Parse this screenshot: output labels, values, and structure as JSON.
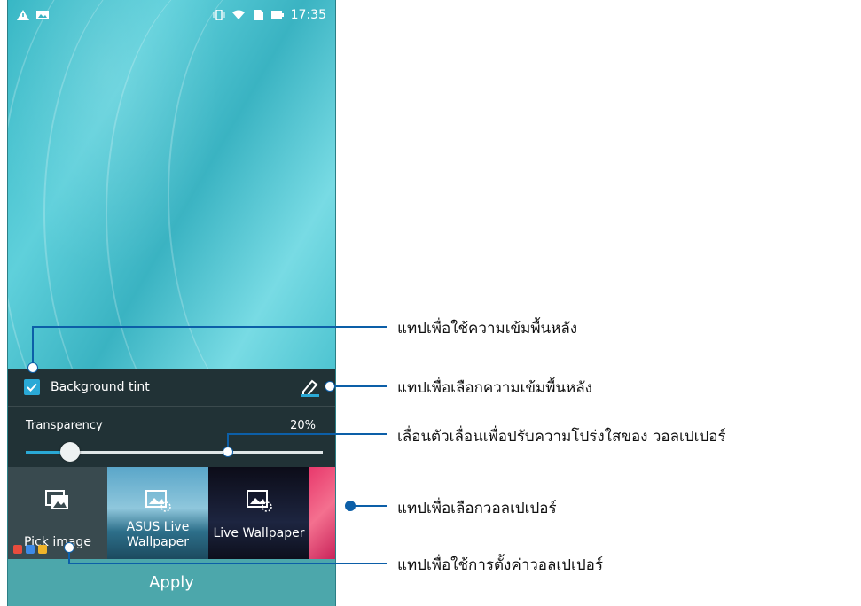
{
  "statusbar": {
    "time": "17:35",
    "icons": [
      "warning-icon",
      "image-notification-icon",
      "vibrate-icon",
      "wifi-icon",
      "sd-card-icon",
      "battery-icon"
    ]
  },
  "tint": {
    "label": "Background tint",
    "checked": true
  },
  "slider": {
    "label": "Transparency",
    "value_text": "20%",
    "value": 0.15
  },
  "tiles": [
    {
      "id": "pick",
      "label": "Pick image"
    },
    {
      "id": "asus",
      "label_line1": "ASUS Live",
      "label_line2": "Wallpaper"
    },
    {
      "id": "live",
      "label": "Live Wallpaper"
    },
    {
      "id": "pink",
      "label": ""
    }
  ],
  "apply_label": "Apply",
  "callouts": {
    "tint_toggle": "แทปเพื่อใช้ความเข้มพื้นหลัง",
    "tint_select": "แทปเพื่อเลือกความเข้มพื้นหลัง",
    "slider": "เลื่อนตัวเลื่อนเพื่อปรับความโปร่งใสของ วอลเปเปอร์",
    "wallpaper_select": "แทปเพื่อเลือกวอลเปเปอร์",
    "apply": "แทปเพื่อใช้การตั้งค่าวอลเปเปอร์"
  },
  "colors": {
    "accent": "#2aa9d6",
    "callout_line": "#0c5fa8",
    "panel": "#213236",
    "apply": "#4ca7ab"
  }
}
